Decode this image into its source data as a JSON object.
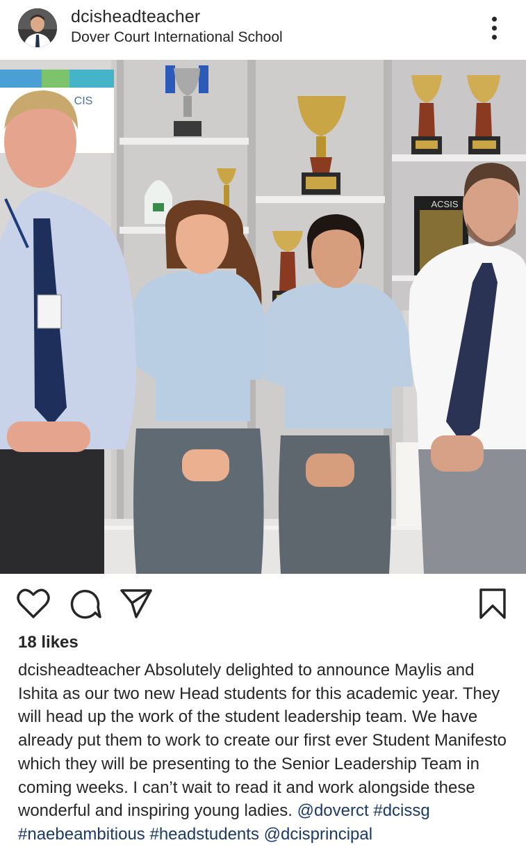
{
  "post": {
    "username": "dcisheadteacher",
    "location": "Dover Court International School",
    "likes_text": "18 likes",
    "caption_user": "dcisheadteacher",
    "caption_text": " Absolutely delighted to announce Maylis and Ishita as our two new Head students for this academic year. They will head up the work of the student leadership team.  We have already put them to work to create our first ever Student Manifesto which they will be presenting to the Senior Leadership Team in coming weeks.  I can’t wait to read it and work alongside these wonderful and inspiring young ladies.",
    "tags": [
      "@doverct",
      "#dcissg",
      "#naebeambitious",
      "#headstudents",
      "@dcisprincipal"
    ]
  },
  "photo": {
    "signs": {
      "cis": "CIS",
      "acsis": "ACSIS"
    }
  },
  "icons": {
    "like": "heart-icon",
    "comment": "comment-icon",
    "share": "send-icon",
    "save": "bookmark-icon",
    "more": "more-vertical-icon"
  },
  "colors": {
    "text": "#262626",
    "hashtag": "#1b3a6b"
  }
}
